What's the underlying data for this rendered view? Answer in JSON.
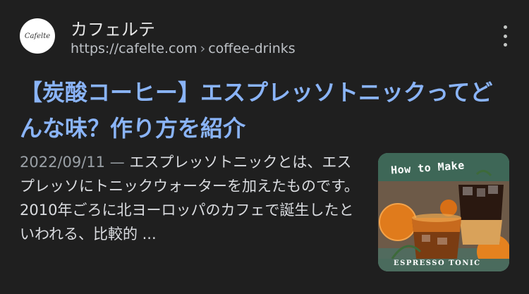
{
  "result": {
    "site_name": "カフェルテ",
    "favicon_text": "Cafelte",
    "url_domain": "https://cafelte.com",
    "url_separator": "›",
    "url_path": "coffee-drinks",
    "title": "【炭酸コーヒー】エスプレッソトニックってどんな味？作り方を紹介",
    "date": "2022/09/11",
    "date_separator": " — ",
    "snippet": "エスプレッソトニックとは、エスプレッソにトニックウォーターを加えたものです。2010年ごろに北ヨーロッパのカフェで誕生したといわれる、比較的 ...",
    "thumbnail": {
      "top_text": "How to Make",
      "bottom_text": "ESPRESSO TONIC"
    }
  },
  "colors": {
    "background": "#1f1f1f",
    "title_link": "#8ab4f8",
    "url": "#bdc1c6",
    "snippet": "#dadce0"
  },
  "icons": {
    "more": "more-vert-icon",
    "favicon": "site-logo-icon"
  }
}
